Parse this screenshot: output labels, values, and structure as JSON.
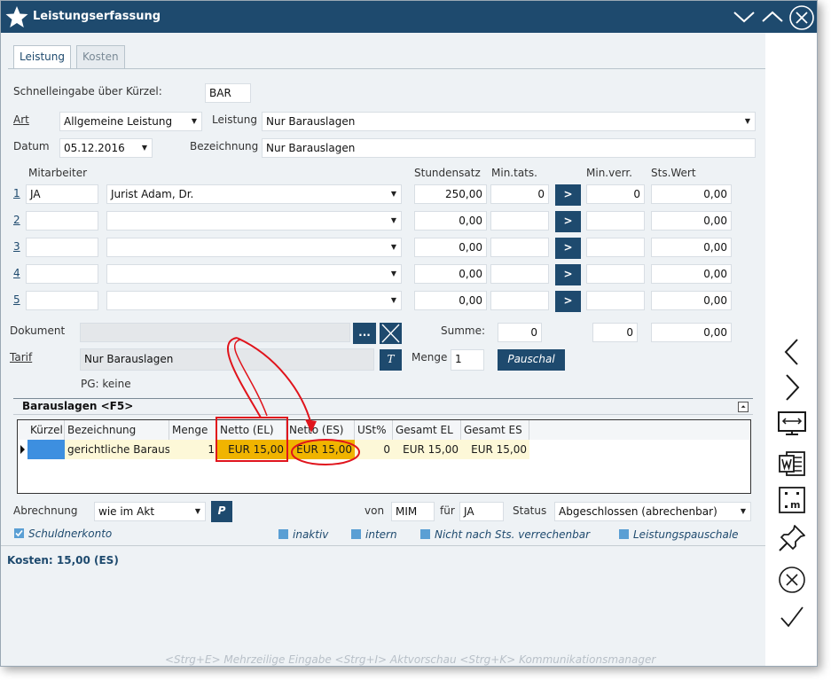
{
  "window": {
    "title": "Leistungserfassung",
    "icon": "star-icon"
  },
  "tabs": [
    {
      "label": "Leistung",
      "active": true
    },
    {
      "label": "Kosten",
      "active": false
    }
  ],
  "form": {
    "schnelleingabe_label": "Schnelleingabe über Kürzel:",
    "schnelleingabe_value": "BAR",
    "art_label": "Art",
    "art_value": "Allgemeine Leistung",
    "leistung_label": "Leistung",
    "leistung_value": "Nur Barauslagen",
    "datum_label": "Datum",
    "datum_value": "05.12.2016",
    "bezeichnung_label": "Bezeichnung",
    "bezeichnung_value": "Nur Barauslagen"
  },
  "staff": {
    "headers": {
      "mitarbeiter": "Mitarbeiter",
      "stundensatz": "Stundensatz",
      "min_tats": "Min.tats.",
      "min_verr": "Min.verr.",
      "sts_wert": "Sts.Wert"
    },
    "rows": [
      {
        "num": "1",
        "kuerzel": "JA",
        "name": "Jurist Adam, Dr.",
        "stundensatz": "250,00",
        "min_tats": "0",
        "min_verr": "0",
        "sts_wert": "0,00"
      },
      {
        "num": "2",
        "kuerzel": "",
        "name": "",
        "stundensatz": "0,00",
        "min_tats": "",
        "min_verr": "",
        "sts_wert": "0,00"
      },
      {
        "num": "3",
        "kuerzel": "",
        "name": "",
        "stundensatz": "0,00",
        "min_tats": "",
        "min_verr": "",
        "sts_wert": "0,00"
      },
      {
        "num": "4",
        "kuerzel": "",
        "name": "",
        "stundensatz": "0,00",
        "min_tats": "",
        "min_verr": "",
        "sts_wert": "0,00"
      },
      {
        "num": "5",
        "kuerzel": "",
        "name": "",
        "stundensatz": "0,00",
        "min_tats": "",
        "min_verr": "",
        "sts_wert": "0,00"
      }
    ],
    "arrow_btn": ">"
  },
  "dokument": {
    "label": "Dokument",
    "value": "",
    "browse_btn": "...",
    "summe_label": "Summe:",
    "summe_min_tats": "0",
    "summe_min_verr": "0",
    "summe_sts_wert": "0,00"
  },
  "tarif": {
    "label": "Tarif",
    "value": "Nur Barauslagen",
    "t_btn": "T",
    "menge_label": "Menge",
    "menge_value": "1",
    "pauschal_btn": "Pauschal",
    "pg_text": "PG:  keine"
  },
  "barauslagen": {
    "title": "Barauslagen <F5>",
    "columns": [
      "Kürzel",
      "Bezeichnung",
      "Menge",
      "Netto (EL)",
      "Netto (ES)",
      "USt%",
      "Gesamt EL",
      "Gesamt ES"
    ],
    "rows": [
      {
        "kuerzel": "",
        "bezeichnung": "gerichtliche Baraus",
        "menge": "1",
        "netto_el": "EUR 15,00",
        "netto_es": "EUR 15,00",
        "ust": "0",
        "gesamt_el": "EUR 15,00",
        "gesamt_es": "EUR 15,00"
      }
    ]
  },
  "abrechnung": {
    "label": "Abrechnung",
    "value": "wie im Akt",
    "p_btn": "P",
    "von_label": "von",
    "von_value": "MIM",
    "fuer_label": "für",
    "fuer_value": "JA",
    "status_label": "Status",
    "status_value": "Abgeschlossen (abrechenbar)"
  },
  "checkboxes": {
    "schuldnerkonto": "Schuldnerkonto",
    "inaktiv": "inaktiv",
    "intern": "intern",
    "nicht_sts": "Nicht nach Sts. verrechenbar",
    "pauschale": "Leistungspauschale"
  },
  "kosten_summary": "Kosten: 15,00 (ES)",
  "footer_hint": "<Strg+E> Mehrzeilige Eingabe <Strg+I> Aktvorschau <Strg+K> Kommunikationsmanager",
  "colors": {
    "titlebar": "#1e4a6e",
    "highlight": "#f0b400",
    "annotation": "#e0141c",
    "checkbox": "#5a9fd4"
  },
  "sidebar_icons": [
    "chevron-left-icon",
    "chevron-right-icon",
    "screen-width-icon",
    "word-icon",
    "placeholder-m-icon",
    "pin-icon",
    "cancel-circle-icon",
    "checkmark-icon"
  ]
}
